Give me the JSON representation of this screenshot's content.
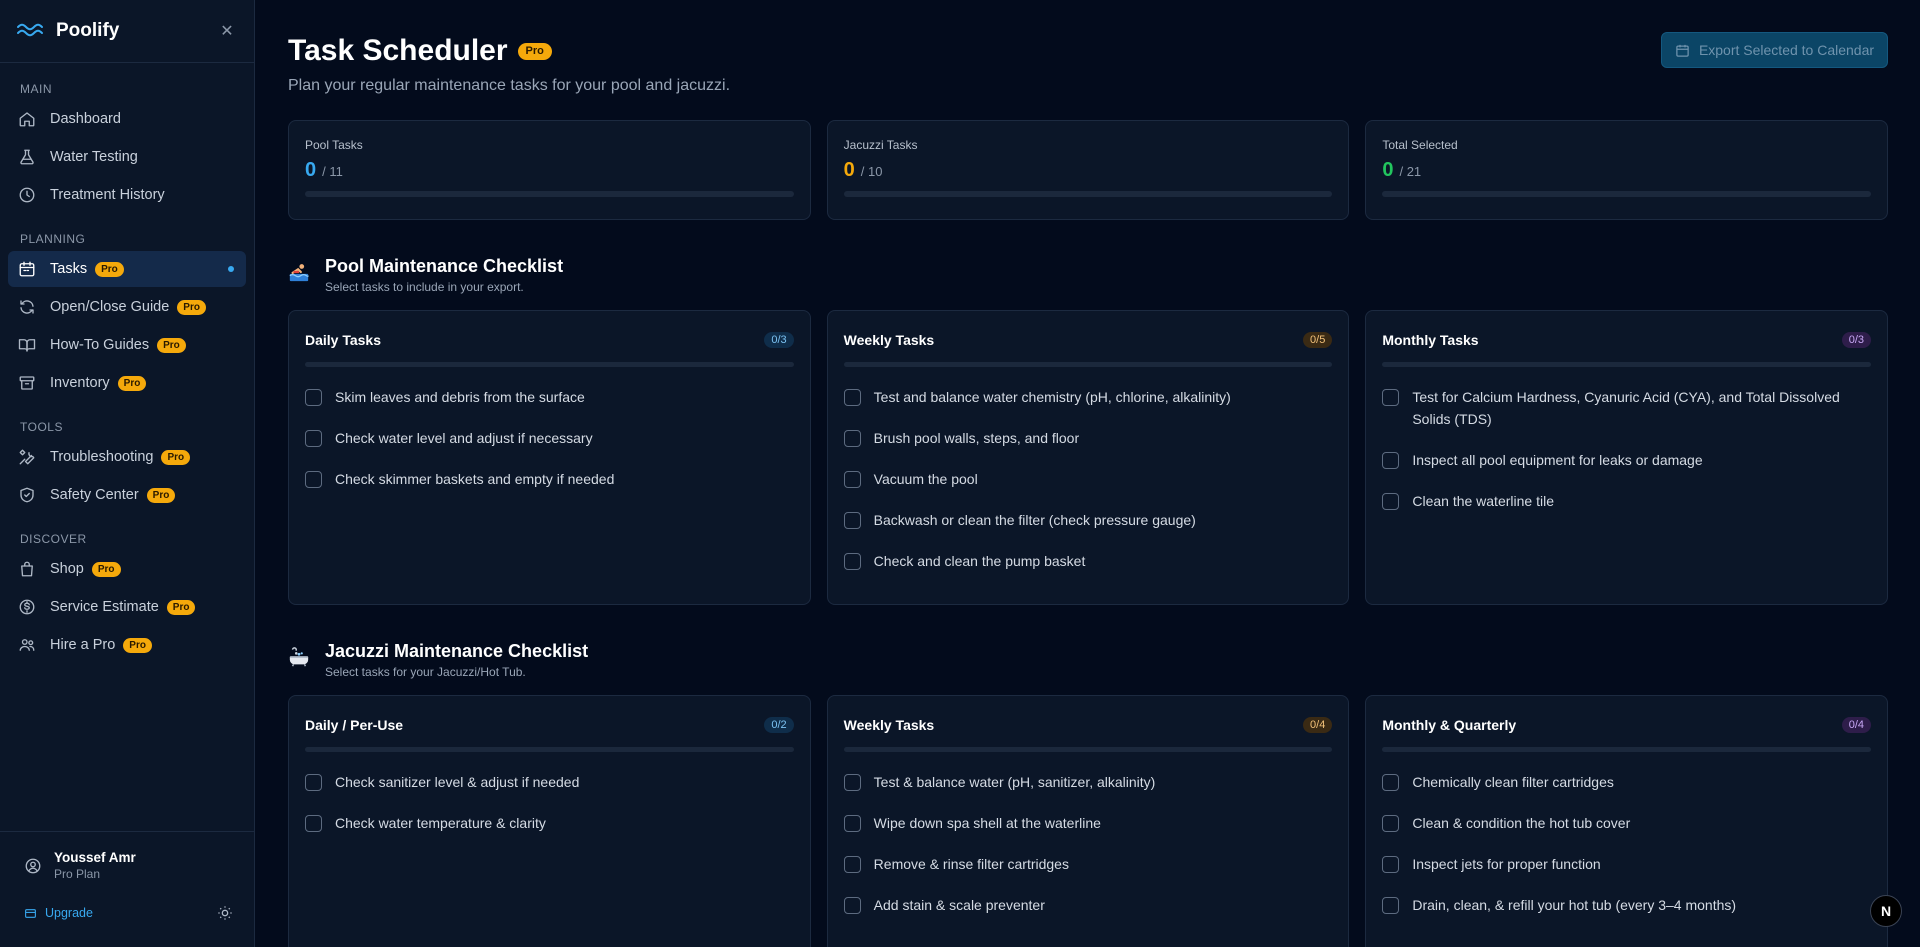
{
  "app": {
    "name": "Poolify"
  },
  "colors": {
    "accent": "#38a9f0",
    "pro_badge": "#f5a90b",
    "pool": "#38a9f0",
    "jacuzzi": "#f5a90b",
    "total": "#22c55e"
  },
  "sidebar": {
    "sections": [
      {
        "title": "MAIN",
        "items": [
          {
            "label": "Dashboard",
            "icon": "home-icon",
            "pro": false
          },
          {
            "label": "Water Testing",
            "icon": "flask-icon",
            "pro": false
          },
          {
            "label": "Treatment History",
            "icon": "clock-icon",
            "pro": false
          }
        ]
      },
      {
        "title": "PLANNING",
        "items": [
          {
            "label": "Tasks",
            "icon": "calendar-icon",
            "pro": true,
            "active": true
          },
          {
            "label": "Open/Close Guide",
            "icon": "refresh-icon",
            "pro": true
          },
          {
            "label": "How-To Guides",
            "icon": "book-icon",
            "pro": true
          },
          {
            "label": "Inventory",
            "icon": "archive-icon",
            "pro": true
          }
        ]
      },
      {
        "title": "TOOLS",
        "items": [
          {
            "label": "Troubleshooting",
            "icon": "wrench-icon",
            "pro": true
          },
          {
            "label": "Safety Center",
            "icon": "shield-icon",
            "pro": true
          }
        ]
      },
      {
        "title": "DISCOVER",
        "items": [
          {
            "label": "Shop",
            "icon": "shopping-bag-icon",
            "pro": true
          },
          {
            "label": "Service Estimate",
            "icon": "dollar-icon",
            "pro": true
          },
          {
            "label": "Hire a Pro",
            "icon": "users-icon",
            "pro": true
          }
        ]
      }
    ],
    "pro_label": "Pro",
    "user": {
      "name": "Youssef Amr",
      "plan": "Pro Plan"
    },
    "upgrade_label": "Upgrade"
  },
  "header": {
    "title": "Task Scheduler",
    "pro_label": "Pro",
    "subtitle": "Plan your regular maintenance tasks for your pool and jacuzzi.",
    "export_label": "Export Selected to Calendar"
  },
  "stats": [
    {
      "label": "Pool Tasks",
      "value": "0",
      "total": "/ 11",
      "color": "#38a9f0"
    },
    {
      "label": "Jacuzzi Tasks",
      "value": "0",
      "total": "/ 10",
      "color": "#f5a90b"
    },
    {
      "label": "Total Selected",
      "value": "0",
      "total": "/ 21",
      "color": "#22c55e"
    }
  ],
  "checklists": [
    {
      "title": "Pool Maintenance Checklist",
      "subtitle": "Select tasks to include in your export.",
      "icon": "swimmer-icon",
      "columns": [
        {
          "title": "Daily Tasks",
          "count": "0/3",
          "badge_bg": "#0f2d4a",
          "badge_fg": "#7cc2f2",
          "tasks": [
            "Skim leaves and debris from the surface",
            "Check water level and adjust if necessary",
            "Check skimmer baskets and empty if needed"
          ]
        },
        {
          "title": "Weekly Tasks",
          "count": "0/5",
          "badge_bg": "#3a2a14",
          "badge_fg": "#f3c27a",
          "tasks": [
            "Test and balance water chemistry (pH, chlorine, alkalinity)",
            "Brush pool walls, steps, and floor",
            "Vacuum the pool",
            "Backwash or clean the filter (check pressure gauge)",
            "Check and clean the pump basket"
          ]
        },
        {
          "title": "Monthly Tasks",
          "count": "0/3",
          "badge_bg": "#2e1d4a",
          "badge_fg": "#c8a8f5",
          "tasks": [
            "Test for Calcium Hardness, Cyanuric Acid (CYA), and Total Dissolved Solids (TDS)",
            "Inspect all pool equipment for leaks or damage",
            "Clean the waterline tile"
          ]
        }
      ]
    },
    {
      "title": "Jacuzzi Maintenance Checklist",
      "subtitle": "Select tasks for your Jacuzzi/Hot Tub.",
      "icon": "bathtub-icon",
      "columns": [
        {
          "title": "Daily / Per-Use",
          "count": "0/2",
          "badge_bg": "#0f2d4a",
          "badge_fg": "#7cc2f2",
          "tasks": [
            "Check sanitizer level & adjust if needed",
            "Check water temperature & clarity"
          ]
        },
        {
          "title": "Weekly Tasks",
          "count": "0/4",
          "badge_bg": "#3a2a14",
          "badge_fg": "#f3c27a",
          "tasks": [
            "Test & balance water (pH, sanitizer, alkalinity)",
            "Wipe down spa shell at the waterline",
            "Remove & rinse filter cartridges",
            "Add stain & scale preventer"
          ]
        },
        {
          "title": "Monthly & Quarterly",
          "count": "0/4",
          "badge_bg": "#2e1d4a",
          "badge_fg": "#c8a8f5",
          "tasks": [
            "Chemically clean filter cartridges",
            "Clean & condition the hot tub cover",
            "Inspect jets for proper function",
            "Drain, clean, & refill your hot tub (every 3–4 months)"
          ]
        }
      ]
    }
  ],
  "fab_label": "N"
}
